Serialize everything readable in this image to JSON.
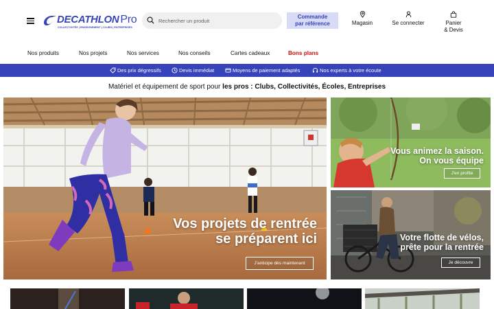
{
  "brand": {
    "name": "DECATHLON",
    "suffix": "Pro",
    "tagline": "COLLECTIVITÉS | ENSEIGNEMENT | CLUBS | ENTREPRISES",
    "color": "#3643ba"
  },
  "search": {
    "placeholder": "Rechercher un produit"
  },
  "header": {
    "order_button": {
      "line1": "Commande",
      "line2": "par référence"
    },
    "store": "Magasin",
    "login": "Se connecter",
    "cart": {
      "line1": "Panier",
      "line2": "& Devis"
    }
  },
  "nav": {
    "items": [
      "Nos produits",
      "Nos projets",
      "Nos services",
      "Nos conseils",
      "Cartes cadeaux",
      "Bons plans"
    ]
  },
  "benefits": {
    "items": [
      "Des prix dégressifs",
      "Devis immédiat",
      "Moyens de paiement adaptés",
      "Nos experts à votre écoute"
    ]
  },
  "pro_line": {
    "prefix": "Matériel et équipement de sport pour ",
    "bold": "les pros : Clubs, Collectivités, Écoles, Entreprises"
  },
  "hero_main": {
    "line1": "Vos projets de rentrée",
    "line2": "se préparent ici",
    "button": "J'anticipe dès maintenant"
  },
  "hero_team": {
    "line1": "Vous animez la saison.",
    "line2": "On vous équipe",
    "button": "J'en profite"
  },
  "hero_bikes": {
    "line1": "Votre flotte de vélos,",
    "line2": "prête pour la rentrée",
    "button": "Je découvre"
  },
  "colors": {
    "accent": "#3643ba",
    "promo": "#c70f0f",
    "order_bg": "#d7dbf6"
  }
}
